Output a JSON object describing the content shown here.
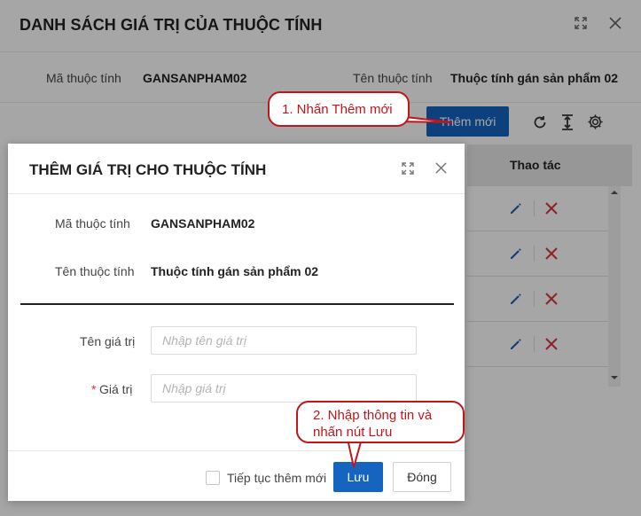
{
  "background_dialog": {
    "title": "DANH SÁCH GIÁ TRỊ CỦA THUỘC TÍNH",
    "attr_code_label": "Mã thuộc tính",
    "attr_code_value": "GANSANPHAM02",
    "attr_name_label": "Tên thuộc tính",
    "attr_name_value": "Thuộc tính gán sản phẩm 02",
    "add_new_label": "Thêm mới",
    "grid_action_header": "Thao tác",
    "row_count": 4
  },
  "dialog": {
    "title": "THÊM GIÁ TRỊ CHO THUỘC TÍNH",
    "attr_code_label": "Mã thuộc tính",
    "attr_code_value": "GANSANPHAM02",
    "attr_name_label": "Tên thuộc tính",
    "attr_name_value": "Thuộc tính gán sản phẩm 02",
    "value_name_label": "Tên giá trị",
    "value_name_placeholder": "Nhập tên giá trị",
    "value_label": "Giá trị",
    "required_mark": "*",
    "value_placeholder": "Nhập giá trị",
    "continue_label": "Tiếp tục thêm mới",
    "save_label": "Lưu",
    "close_label": "Đóng"
  },
  "callouts": {
    "step1": "1. Nhấn Thêm mới",
    "step2_line1": "2. Nhập thông tin và",
    "step2_line2": "nhấn nút Lưu"
  },
  "colors": {
    "primary": "#1565c0",
    "annotation": "#c0161b",
    "edit_icon": "#1f5fad",
    "delete_icon": "#d9363e"
  }
}
